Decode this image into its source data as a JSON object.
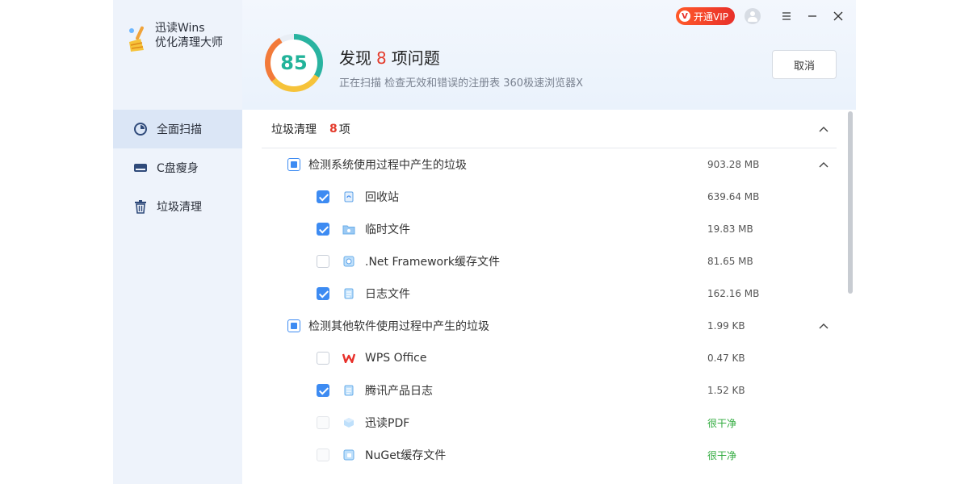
{
  "app": {
    "name_line1": "迅读Wins",
    "name_line2": "优化清理大师"
  },
  "sidebar": {
    "items": [
      {
        "label": "全面扫描",
        "icon": "scan-icon",
        "active": true
      },
      {
        "label": "C盘瘦身",
        "icon": "disk-icon",
        "active": false
      },
      {
        "label": "垃圾清理",
        "icon": "trash-icon",
        "active": false
      }
    ]
  },
  "topbar": {
    "vip_label": "开通VIP",
    "vip_badge": "V"
  },
  "header": {
    "score": "85",
    "headline_prefix": "发现",
    "headline_count": "8",
    "headline_suffix": "项问题",
    "status": "正在扫描 检查无效和错误的注册表 360极速浏览器X",
    "cancel_label": "取消"
  },
  "section": {
    "title": "垃圾清理",
    "count": "8",
    "unit": "项"
  },
  "groups": [
    {
      "label": "检测系统使用过程中产生的垃圾",
      "size": "903.28 MB",
      "items": [
        {
          "label": "回收站",
          "size": "639.64 MB",
          "checked": true
        },
        {
          "label": "临时文件",
          "size": "19.83 MB",
          "checked": true
        },
        {
          "label": ".Net Framework缓存文件",
          "size": "81.65 MB",
          "checked": false
        },
        {
          "label": "日志文件",
          "size": "162.16 MB",
          "checked": true
        }
      ]
    },
    {
      "label": "检测其他软件使用过程中产生的垃圾",
      "size": "1.99 KB",
      "items": [
        {
          "label": "WPS Office",
          "size": "0.47 KB",
          "checked": false
        },
        {
          "label": "腾讯产品日志",
          "size": "1.52 KB",
          "checked": true
        },
        {
          "label": "迅读PDF",
          "size": "很干净",
          "checked": false
        },
        {
          "label": "NuGet缓存文件",
          "size": "很干净",
          "checked": false
        }
      ]
    }
  ],
  "colors": {
    "accent": "#3d8bf2",
    "danger": "#e43b2c",
    "clean": "#2eaa3c",
    "score": "#22b39a"
  }
}
